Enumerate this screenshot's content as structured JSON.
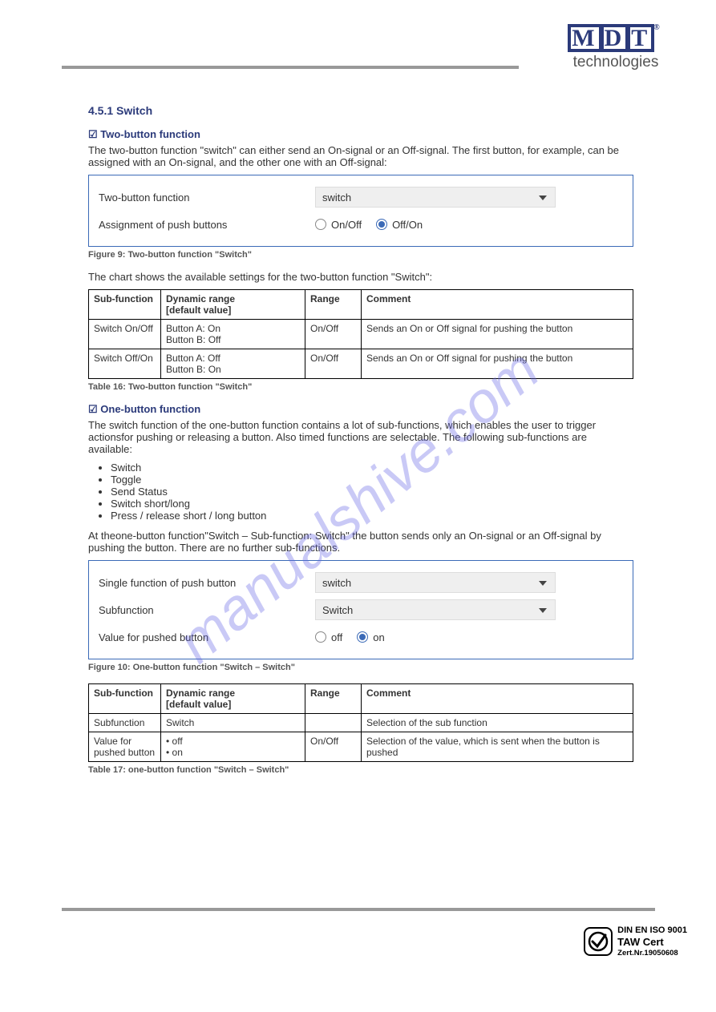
{
  "brand": {
    "name": "MDT",
    "sub": "technologies",
    "reg": "®"
  },
  "watermark": "manualshive.com",
  "sec1": {
    "heading": "4.5.1 Switch",
    "sub_a_head": "☑ Two-button function",
    "sub_a_text": "The two-button function \"switch\" can either send an On-signal or an Off-signal. The first button, for example, can be assigned with an On-signal, and the other one with an Off-signal:",
    "fig1": {
      "row1_label": "Two-button function",
      "row1_value": "switch",
      "row2_label": "Assignment of push buttons",
      "opt_a": "On/Off",
      "opt_b": "Off/On"
    },
    "caption1": "Figure 9: Two-button function \"Switch\"",
    "chart1_intro": "The chart shows the available settings for the two-button function \"Switch\":",
    "table1": {
      "h1": "Sub-function",
      "h2": "Dynamic range\n[default value]",
      "h3": "Range",
      "h4": "Comment",
      "r1c1": "Switch On/Off",
      "r1c2": "Button A: On\nButton B: Off",
      "r1c3": "On/Off",
      "r1c4": "Sends an On or Off signal for pushing the button",
      "r2c1": "Switch Off/On",
      "r2c2": "Button A: Off\nButton B: On",
      "r2c3": "On/Off",
      "r2c4": "Sends an On or Off signal for pushing the button"
    },
    "caption1b": "Table 16: Two-button function \"Switch\"",
    "sub_b_head": "☑ One-button function",
    "sub_b_text": "The switch function of the one-button function contains a lot of sub-functions, which enables the user to trigger actionsfor pushing or releasing a button. Also timed functions are selectable. The following sub-functions are available:",
    "list": [
      "Switch",
      "Toggle",
      "Send Status",
      "Switch short/long",
      "Press / release short / long button"
    ],
    "fig2_intro": "At theone-button function\"Switch – Sub-function: Switch\" the button sends only an On-signal or an Off-signal by pushing the button. There are no further sub-functions.",
    "fig2": {
      "row1_label": "Single function of push button",
      "row1_value": "switch",
      "row2_label": "Subfunction",
      "row2_value": "Switch",
      "row3_label": "Value for pushed button",
      "opt_a": "off",
      "opt_b": "on"
    },
    "caption2": "Figure 10: One-button function \"Switch – Switch\"",
    "table2": {
      "h1": "Sub-function",
      "h2": "Dynamic range\n[default value]",
      "h3": "Range",
      "h4": "Comment",
      "r1c1": "Subfunction",
      "r1c2": "Switch",
      "r1c3": "",
      "r1c4": "Selection of the sub function",
      "r2c1": "Value for pushed button",
      "r2c2": "• off\n• on",
      "r2c3": "On/Off",
      "r2c4": "Selection of the value, which is sent when the button is pushed"
    },
    "caption2b": "Table 17: one-button function \"Switch – Switch\""
  },
  "cert": {
    "c1": "DIN EN ISO 9001",
    "c2": "TAW Cert",
    "c3": "Zert.Nr.19050608"
  }
}
